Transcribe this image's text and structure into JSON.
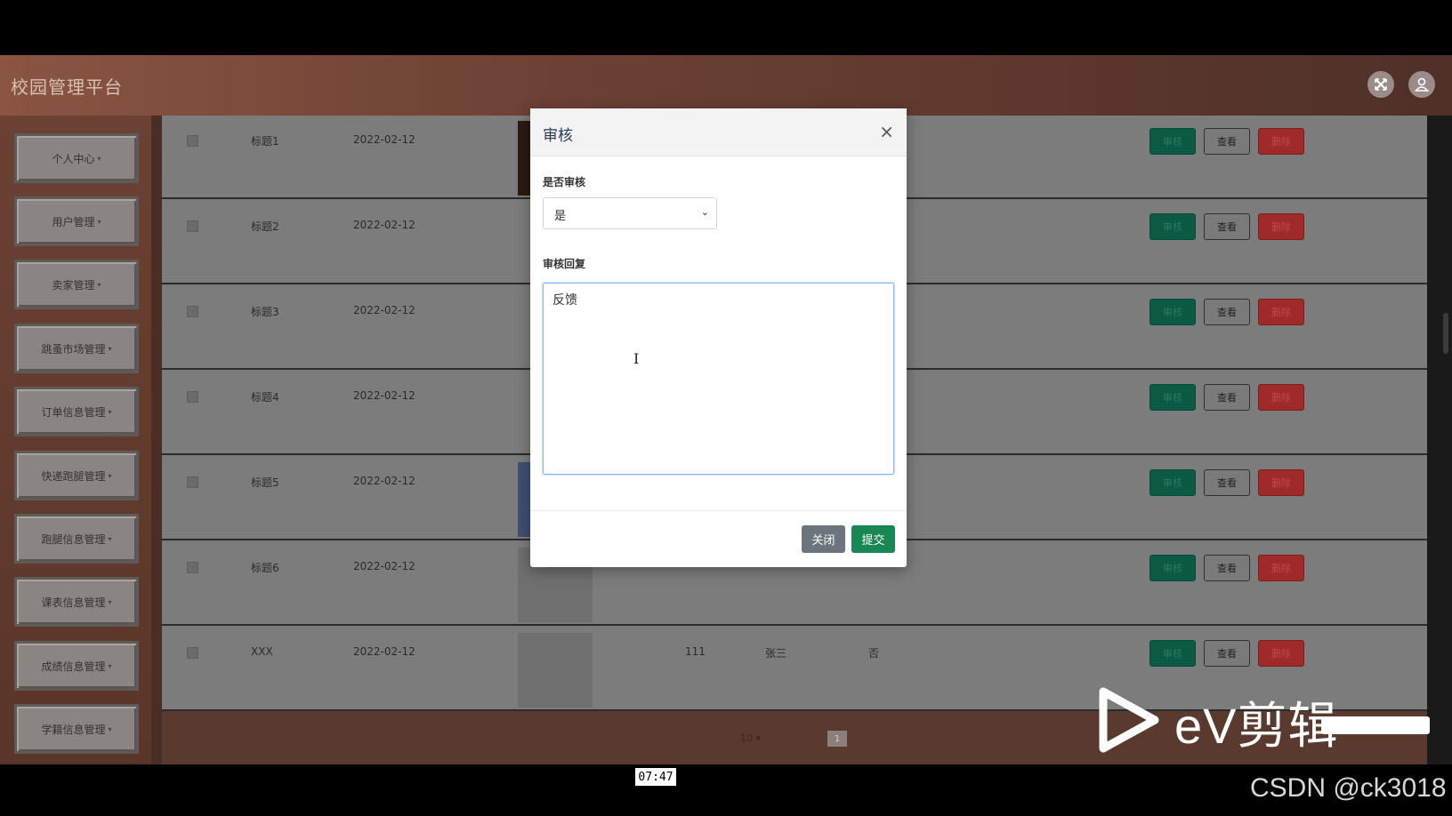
{
  "app": {
    "title": "校园管理平台"
  },
  "header_icons": {
    "fullscreen": "fullscreen-icon",
    "user": "user-icon"
  },
  "sidebar": {
    "items": [
      {
        "label": "个人中心"
      },
      {
        "label": "用户管理"
      },
      {
        "label": "卖家管理"
      },
      {
        "label": "跳蚤市场管理"
      },
      {
        "label": "订单信息管理"
      },
      {
        "label": "快递跑腿管理"
      },
      {
        "label": "跑腿信息管理"
      },
      {
        "label": "课表信息管理"
      },
      {
        "label": "成绩信息管理"
      },
      {
        "label": "学籍信息管理"
      }
    ],
    "caret": "▾"
  },
  "table": {
    "rows": [
      {
        "title": "标题1",
        "date": "2022-02-12",
        "c1": "",
        "c2": "",
        "c3": ""
      },
      {
        "title": "标题2",
        "date": "2022-02-12",
        "c1": "",
        "c2": "",
        "c3": ""
      },
      {
        "title": "标题3",
        "date": "2022-02-12",
        "c1": "",
        "c2": "",
        "c3": ""
      },
      {
        "title": "标题4",
        "date": "2022-02-12",
        "c1": "",
        "c2": "",
        "c3": ""
      },
      {
        "title": "标题5",
        "date": "2022-02-12",
        "c1": "",
        "c2": "",
        "c3": ""
      },
      {
        "title": "标题6",
        "date": "2022-02-12",
        "c1": "",
        "c2": "",
        "c3": ""
      },
      {
        "title": "XXX",
        "date": "2022-02-12",
        "c1": "111",
        "c2": "张三",
        "c3": "否"
      }
    ],
    "actions": {
      "audit": "审核",
      "view": "查看",
      "delete": "删除"
    }
  },
  "pager": {
    "page_size": "10",
    "current_page": "1"
  },
  "modal": {
    "title": "审核",
    "close_glyph": "×",
    "approve_label": "是否审核",
    "approve_value": "是",
    "reply_label": "审核回复",
    "reply_value": "反馈",
    "close_button": "关闭",
    "submit_button": "提交"
  },
  "overlay": {
    "timestamp": "07:47",
    "watermark": "CSDN @ck3018",
    "brand_text": "eV剪辑"
  },
  "colors": {
    "audit": "#198754",
    "delete": "#dc3545",
    "close": "#6c757d"
  }
}
